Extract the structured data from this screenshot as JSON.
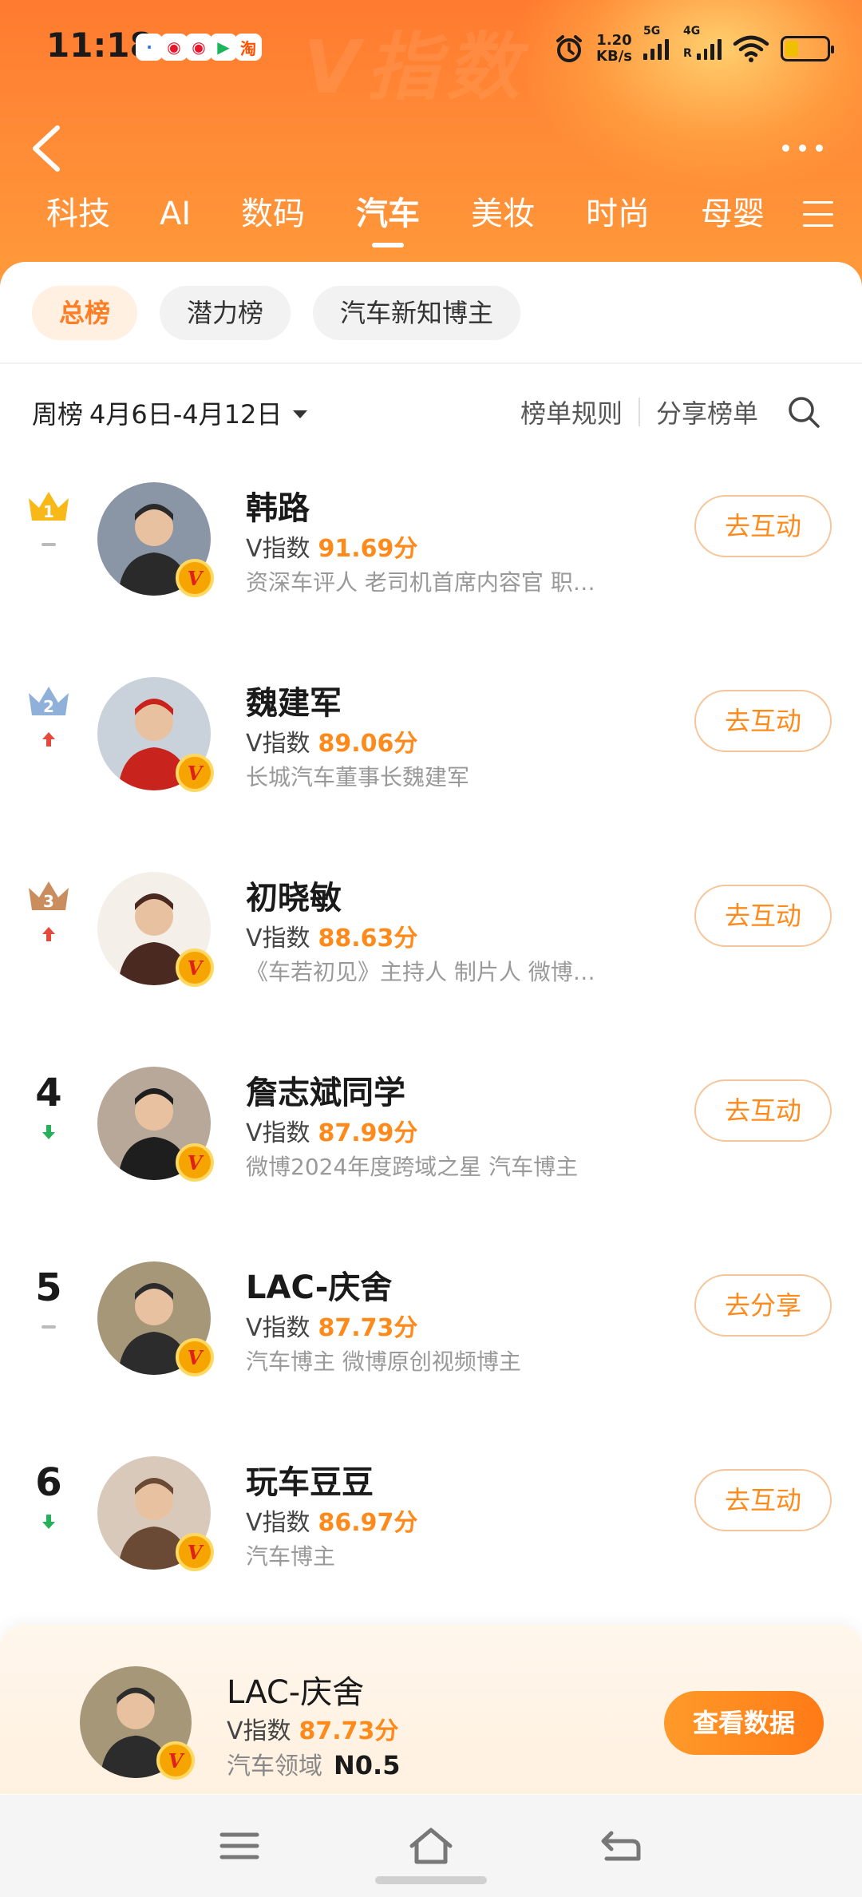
{
  "status_bar": {
    "time": "11:18",
    "apps": [
      {
        "name": "baidu-icon",
        "glyph": "·",
        "color": "#2f6df6"
      },
      {
        "name": "weibo-icon",
        "glyph": "◉",
        "color": "#e6162d"
      },
      {
        "name": "weibo-icon",
        "glyph": "◉",
        "color": "#e6162d"
      },
      {
        "name": "video-app-icon",
        "glyph": "▶",
        "color": "#1bb55c"
      },
      {
        "name": "taobao-icon",
        "glyph": "淘",
        "color": "#ff5000"
      }
    ],
    "speed_value": "1.20",
    "speed_unit": "KB/s",
    "signal1_label": "5G",
    "signal2_label": "4G",
    "signal2_sub": "R"
  },
  "header": {
    "watermark": "V指数",
    "categories": [
      "科技",
      "AI",
      "数码",
      "汽车",
      "美妆",
      "时尚",
      "母婴"
    ],
    "active_category": "汽车"
  },
  "filters": {
    "chips": [
      "总榜",
      "潜力榜",
      "汽车新知博主"
    ],
    "active": "总榜"
  },
  "period": {
    "label": "周榜",
    "range": "4月6日-4月12日"
  },
  "toolbar": {
    "rules": "榜单规则",
    "share": "分享榜单"
  },
  "score_label": "V指数",
  "ranking": [
    {
      "rank": "1",
      "trend": "same",
      "name": "韩路",
      "score": "91.69分",
      "desc": "资深车评人 老司机首席内容官 职…",
      "action": "去互动",
      "avatar_bg": "#8a96a6",
      "avatar_fg": "#2a2a2a"
    },
    {
      "rank": "2",
      "trend": "up",
      "name": "魏建军",
      "score": "89.06分",
      "desc": "长城汽车董事长魏建军",
      "action": "去互动",
      "avatar_bg": "#c9d2da",
      "avatar_fg": "#c8231d"
    },
    {
      "rank": "3",
      "trend": "up",
      "name": "初晓敏",
      "score": "88.63分",
      "desc": "《车若初见》主持人 制片人 微博…",
      "action": "去互动",
      "avatar_bg": "#f4efe9",
      "avatar_fg": "#4a2a20"
    },
    {
      "rank": "4",
      "trend": "down",
      "name": "詹志斌同学",
      "score": "87.99分",
      "desc": "微博2024年度跨域之星 汽车博主",
      "action": "去互动",
      "avatar_bg": "#b7a899",
      "avatar_fg": "#1e1e1e"
    },
    {
      "rank": "5",
      "trend": "same",
      "name": "LAC-庆舍",
      "score": "87.73分",
      "desc": "汽车博主 微博原创视频博主",
      "action": "去分享",
      "avatar_bg": "#a79779",
      "avatar_fg": "#2c2c2c"
    },
    {
      "rank": "6",
      "trend": "down",
      "name": "玩车豆豆",
      "score": "86.97分",
      "desc": "汽车博主",
      "action": "去互动",
      "avatar_bg": "#d9c9bb",
      "avatar_fg": "#6a4a34"
    }
  ],
  "mine": {
    "name": "LAC-庆舍",
    "score": "87.73分",
    "field": "汽车领域",
    "rank": "N0.5",
    "view_button": "查看数据"
  },
  "colors": {
    "accent": "#ff8a1c",
    "header_orange": "#ff7a2f",
    "up": "#e5493d",
    "down": "#27b05a",
    "gold": "#f7b818",
    "silver": "#8fb0d8",
    "bronze": "#c98d5e"
  }
}
